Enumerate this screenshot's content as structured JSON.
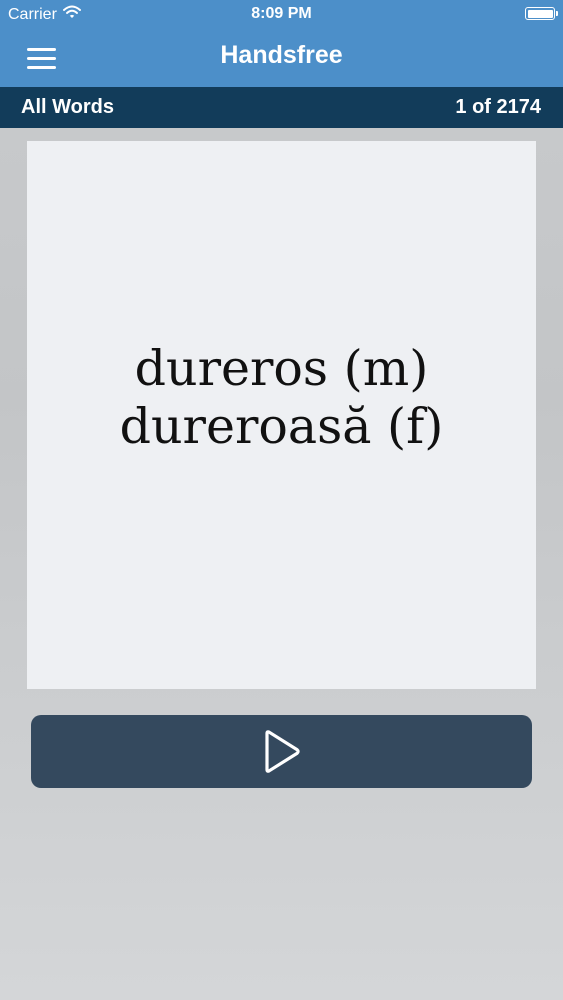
{
  "status_bar": {
    "carrier": "Carrier",
    "time": "8:09 PM",
    "wifi_icon": "wifi-icon",
    "battery_icon": "battery-icon"
  },
  "nav": {
    "title": "Handsfree",
    "menu_icon": "hamburger-menu-icon"
  },
  "subheader": {
    "list_name": "All Words",
    "counter": "1 of 2174"
  },
  "card": {
    "lines": [
      "dureros (m)",
      "dureroasă (f)"
    ]
  },
  "play_button": {
    "icon": "play-icon"
  },
  "colors": {
    "nav_blue": "#4c8fc9",
    "subheader_navy": "#123c5a",
    "card_bg": "#eef0f3",
    "button_bg": "#34495e"
  }
}
